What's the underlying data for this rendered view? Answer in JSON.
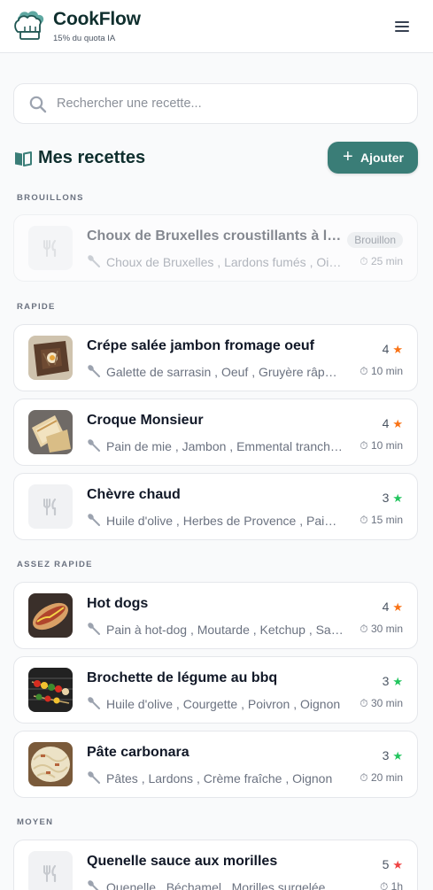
{
  "header": {
    "app_name": "CookFlow",
    "quota": "15% du quota IA",
    "menu_icon": "hamburger-icon"
  },
  "search": {
    "placeholder": "Rechercher une recette..."
  },
  "section": {
    "title": "Mes recettes",
    "add_label": "Ajouter"
  },
  "colors": {
    "accent": "#3a7d77",
    "star_orange": "#f97316",
    "star_green": "#22c55e",
    "star_red": "#ef4444"
  },
  "groups": [
    {
      "label": "BROUILLONS"
    },
    {
      "label": "RAPIDE"
    },
    {
      "label": "ASSEZ RAPIDE"
    },
    {
      "label": "MOYEN"
    }
  ],
  "recipes": [
    {
      "title": "Choux de Bruxelles croustillants à la poêle",
      "ingredients": "Choux de Bruxelles , Lardons fumés , Oignon",
      "badge": "Brouillon",
      "time": "⏱ 25 min",
      "image": "none"
    },
    {
      "title": "Crépe salée jambon fromage oeuf",
      "ingredients": "Galette de sarrasin , Oeuf , Gruyère râpé , Jambon",
      "rating": "4",
      "star": "★",
      "star_color": "orange",
      "time": "⏱ 10 min",
      "image": "galette-photo"
    },
    {
      "title": "Croque Monsieur",
      "ingredients": "Pain de mie , Jambon , Emmental tranché , Beurre",
      "rating": "4",
      "star": "★",
      "star_color": "orange",
      "time": "⏱ 10 min",
      "image": "croque-photo"
    },
    {
      "title": "Chèvre chaud",
      "ingredients": "Huile d'olive , Herbes de Provence , Pain , Chèvre",
      "rating": "3",
      "star": "★",
      "star_color": "green",
      "time": "⏱ 15 min",
      "image": "none"
    },
    {
      "title": "Hot dogs",
      "ingredients": "Pain à hot-dog , Moutarde , Ketchup , Saucisse",
      "rating": "4",
      "star": "★",
      "star_color": "orange",
      "time": "⏱ 30 min",
      "image": "hotdog-photo"
    },
    {
      "title": "Brochette de légume au bbq",
      "ingredients": "Huile d'olive , Courgette , Poivron , Oignon",
      "rating": "3",
      "star": "★",
      "star_color": "green",
      "time": "⏱ 30 min",
      "image": "bbq-photo"
    },
    {
      "title": "Pâte carbonara",
      "ingredients": "Pâtes , Lardons , Crème fraîche , Oignon",
      "rating": "3",
      "star": "★",
      "star_color": "green",
      "time": "⏱ 20 min",
      "image": "carbonara-photo"
    },
    {
      "title": "Quenelle sauce aux morilles",
      "ingredients": "Quenelle , Béchamel , Morilles surgelée",
      "rating": "5",
      "star": "★",
      "star_color": "red",
      "time": "⏱ 1h",
      "image": "none"
    }
  ]
}
